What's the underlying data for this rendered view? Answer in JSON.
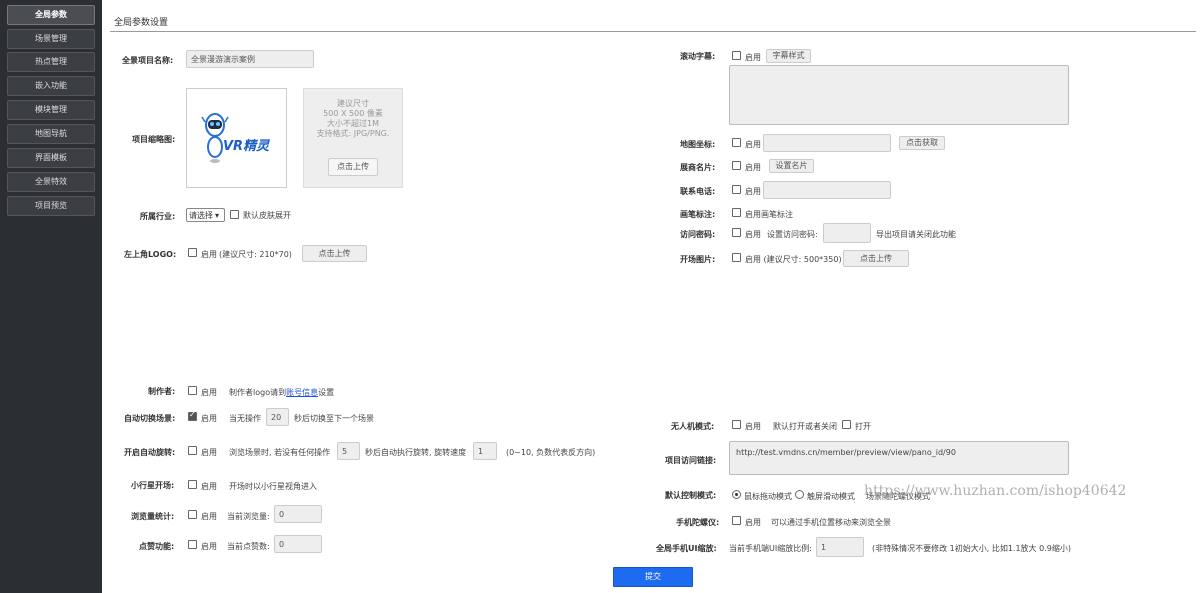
{
  "sidebar": {
    "items": [
      {
        "label": "全局参数",
        "active": true
      },
      {
        "label": "场景管理"
      },
      {
        "label": "热点管理"
      },
      {
        "label": "嵌入功能"
      },
      {
        "label": "模块管理"
      },
      {
        "label": "地图导航"
      },
      {
        "label": "界面模板"
      },
      {
        "label": "全景特效"
      },
      {
        "label": "项目预览"
      }
    ]
  },
  "page": {
    "title": "全局参数设置"
  },
  "left": {
    "project_name": {
      "label": "全景项目名称:",
      "value": "全景漫游演示案例"
    },
    "thumbnail": {
      "label": "项目缩略图:",
      "logo_text": "VR精灵",
      "hint_line1": "建议尺寸",
      "hint_line2": "500 X 500 像素",
      "hint_line3": "大小不超过1M",
      "hint_line4": "支持格式: JPG/PNG.",
      "upload_button": "点击上传"
    },
    "industry": {
      "label": "所属行业:",
      "select_value": "请选择",
      "checkbox_label": "默认皮肤展开"
    },
    "top_left_logo": {
      "label": "左上角LOGO:",
      "checkbox_label": "启用",
      "hint": "(建议尺寸: 210*70)",
      "upload_button": "点击上传"
    },
    "author": {
      "label": "制作者:",
      "checkbox_label": "启用",
      "hint_prefix": "制作者logo请到",
      "link_text": "账号信息",
      "hint_suffix": "设置"
    },
    "auto_switch": {
      "label": "自动切换场景:",
      "checkbox_label": "启用",
      "prefix": "当无操作",
      "seconds": "20",
      "suffix": "秒后切换至下一个场景"
    },
    "auto_rotate": {
      "label": "开启自动旋转:",
      "checkbox_label": "启用",
      "prefix": "浏览场景时, 若没有任何操作",
      "seconds": "5",
      "middle": "秒后自动执行旋转, 旋转速度",
      "speed": "1",
      "suffix": "(0~10, 负数代表反方向)"
    },
    "planet_open": {
      "label": "小行星开场:",
      "checkbox_label": "启用",
      "hint": "开场时以小行星视角进入"
    },
    "views": {
      "label": "浏览量统计:",
      "checkbox_label": "启用",
      "prefix": "当前浏览量:",
      "value": "0"
    },
    "likes": {
      "label": "点赞功能:",
      "checkbox_label": "启用",
      "prefix": "当前点赞数:",
      "value": "0"
    }
  },
  "right": {
    "marquee": {
      "label": "滚动字幕:",
      "checkbox_label": "启用",
      "style_button": "字幕样式"
    },
    "map_coords": {
      "label": "地图坐标:",
      "checkbox_label": "启用",
      "button": "点击获取"
    },
    "business_card": {
      "label": "展商名片:",
      "checkbox_label": "启用",
      "button": "设置名片"
    },
    "phone": {
      "label": "联系电话:",
      "checkbox_label": "启用"
    },
    "brush": {
      "label": "画笔标注:",
      "checkbox_label": "启用画笔标注"
    },
    "password": {
      "label": "访问密码:",
      "checkbox_label": "启用",
      "prefix": "设置访问密码:",
      "suffix": "导出项目请关闭此功能"
    },
    "opening_image": {
      "label": "开场图片:",
      "checkbox_label": "启用 (建议尺寸: 500*350)",
      "button": "点击上传"
    },
    "drone_mode": {
      "label": "无人机模式:",
      "checkbox_label": "启用",
      "option2": "默认打开或者关闭",
      "option3": "打开"
    },
    "access_link": {
      "label": "项目访问链接:",
      "value": "http://test.vmdns.cn/member/preview/view/pano_id/90"
    },
    "control_mode": {
      "label": "默认控制模式:",
      "option1": "鼠标拖动模式",
      "option2": "触屏滑动模式",
      "option3": "场景随陀螺仪模式"
    },
    "gyroscope": {
      "label": "手机陀螺仪:",
      "checkbox_label": "启用",
      "hint": "可以通过手机位置移动来浏览全景"
    },
    "mobile_ui": {
      "label": "全局手机UI缩放:",
      "prefix": "当前手机端UI缩放比例:",
      "value": "1",
      "hint": "(非特殊情况不要修改 1初始大小, 比如1.1放大 0.9缩小)"
    }
  },
  "watermark": "https://www.huzhan.com/ishop40642",
  "submit_label": "提交"
}
